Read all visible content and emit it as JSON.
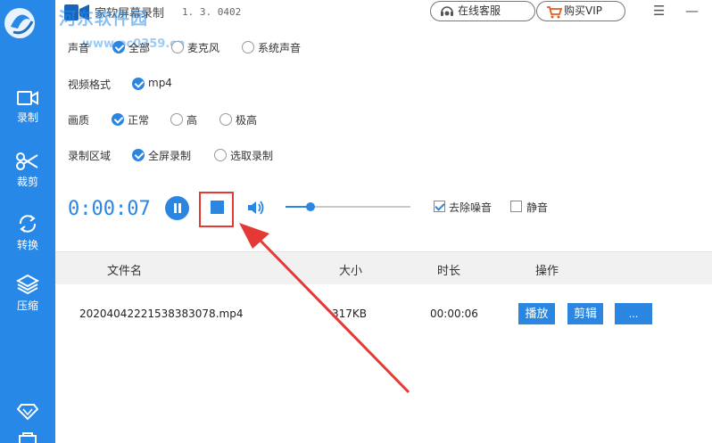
{
  "app": {
    "title": "家软屏幕录制",
    "version": "1. 3. 0402",
    "watermark": "河东软件园",
    "watermark_url": "www.pc0359.cn"
  },
  "header": {
    "service_label": "在线客服",
    "vip_label": "购买VIP",
    "menu_glyph": "☰",
    "minimize_glyph": "—"
  },
  "sidebar": {
    "items": [
      {
        "label": "录制",
        "icon": "video-camera-icon"
      },
      {
        "label": "裁剪",
        "icon": "scissors-icon"
      },
      {
        "label": "转换",
        "icon": "refresh-icon"
      },
      {
        "label": "压缩",
        "icon": "layers-icon"
      }
    ]
  },
  "settings": {
    "audio": {
      "label": "声音",
      "options": [
        {
          "label": "全部",
          "checked": true
        },
        {
          "label": "麦克风",
          "checked": false
        },
        {
          "label": "系统声音",
          "checked": false
        }
      ]
    },
    "format": {
      "label": "视频格式",
      "options": [
        {
          "label": "mp4",
          "checked": true
        }
      ]
    },
    "quality": {
      "label": "画质",
      "options": [
        {
          "label": "正常",
          "checked": true
        },
        {
          "label": "高",
          "checked": false
        },
        {
          "label": "极高",
          "checked": false
        }
      ]
    },
    "area": {
      "label": "录制区域",
      "options": [
        {
          "label": "全屏录制",
          "checked": true
        },
        {
          "label": "选取录制",
          "checked": false
        }
      ]
    }
  },
  "controls": {
    "timer": "0:00:07",
    "volume_level": 0.2,
    "denoise_label": "去除噪音",
    "denoise_checked": true,
    "mute_label": "静音",
    "mute_checked": false
  },
  "table": {
    "headers": [
      "文件名",
      "大小",
      "时长",
      "操作"
    ],
    "rows": [
      {
        "name": "20204042221538383078.mp4",
        "size": "317KB",
        "duration": "00:00:06",
        "actions": [
          "播放",
          "剪辑",
          "..."
        ]
      }
    ]
  },
  "colors": {
    "accent": "#2a86e0",
    "sidebar": "#2788e8",
    "highlight": "#e53935"
  }
}
